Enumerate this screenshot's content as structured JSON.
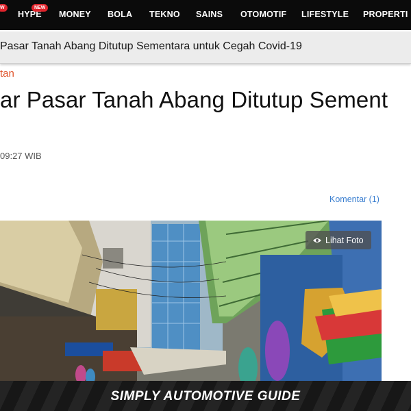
{
  "nav": {
    "items": [
      {
        "label": "HYPE",
        "badge": "NEW"
      },
      {
        "label": "MONEY"
      },
      {
        "label": "BOLA"
      },
      {
        "label": "TEKNO"
      },
      {
        "label": "SAINS"
      },
      {
        "label": "OTOMOTIF"
      },
      {
        "label": "LIFESTYLE"
      },
      {
        "label": "PROPERTI"
      }
    ],
    "left_badge": "W"
  },
  "breaking": {
    "text": "Pasar Tanah Abang Ditutup Sementara untuk Cegah Covid-19"
  },
  "article": {
    "category": "tan",
    "headline": "ar Pasar Tanah Abang Ditutup Sement",
    "timestamp": "09:27 WIB",
    "comments_label": "Komentar (1)",
    "photo_button_label": "Lihat Foto"
  },
  "ad": {
    "text": "SIMPLY AUTOMOTIVE GUIDE"
  },
  "colors": {
    "nav_bg": "#0b0b0b",
    "badge": "#e0242c",
    "category": "#e0542c",
    "link": "#3b7fd0"
  }
}
